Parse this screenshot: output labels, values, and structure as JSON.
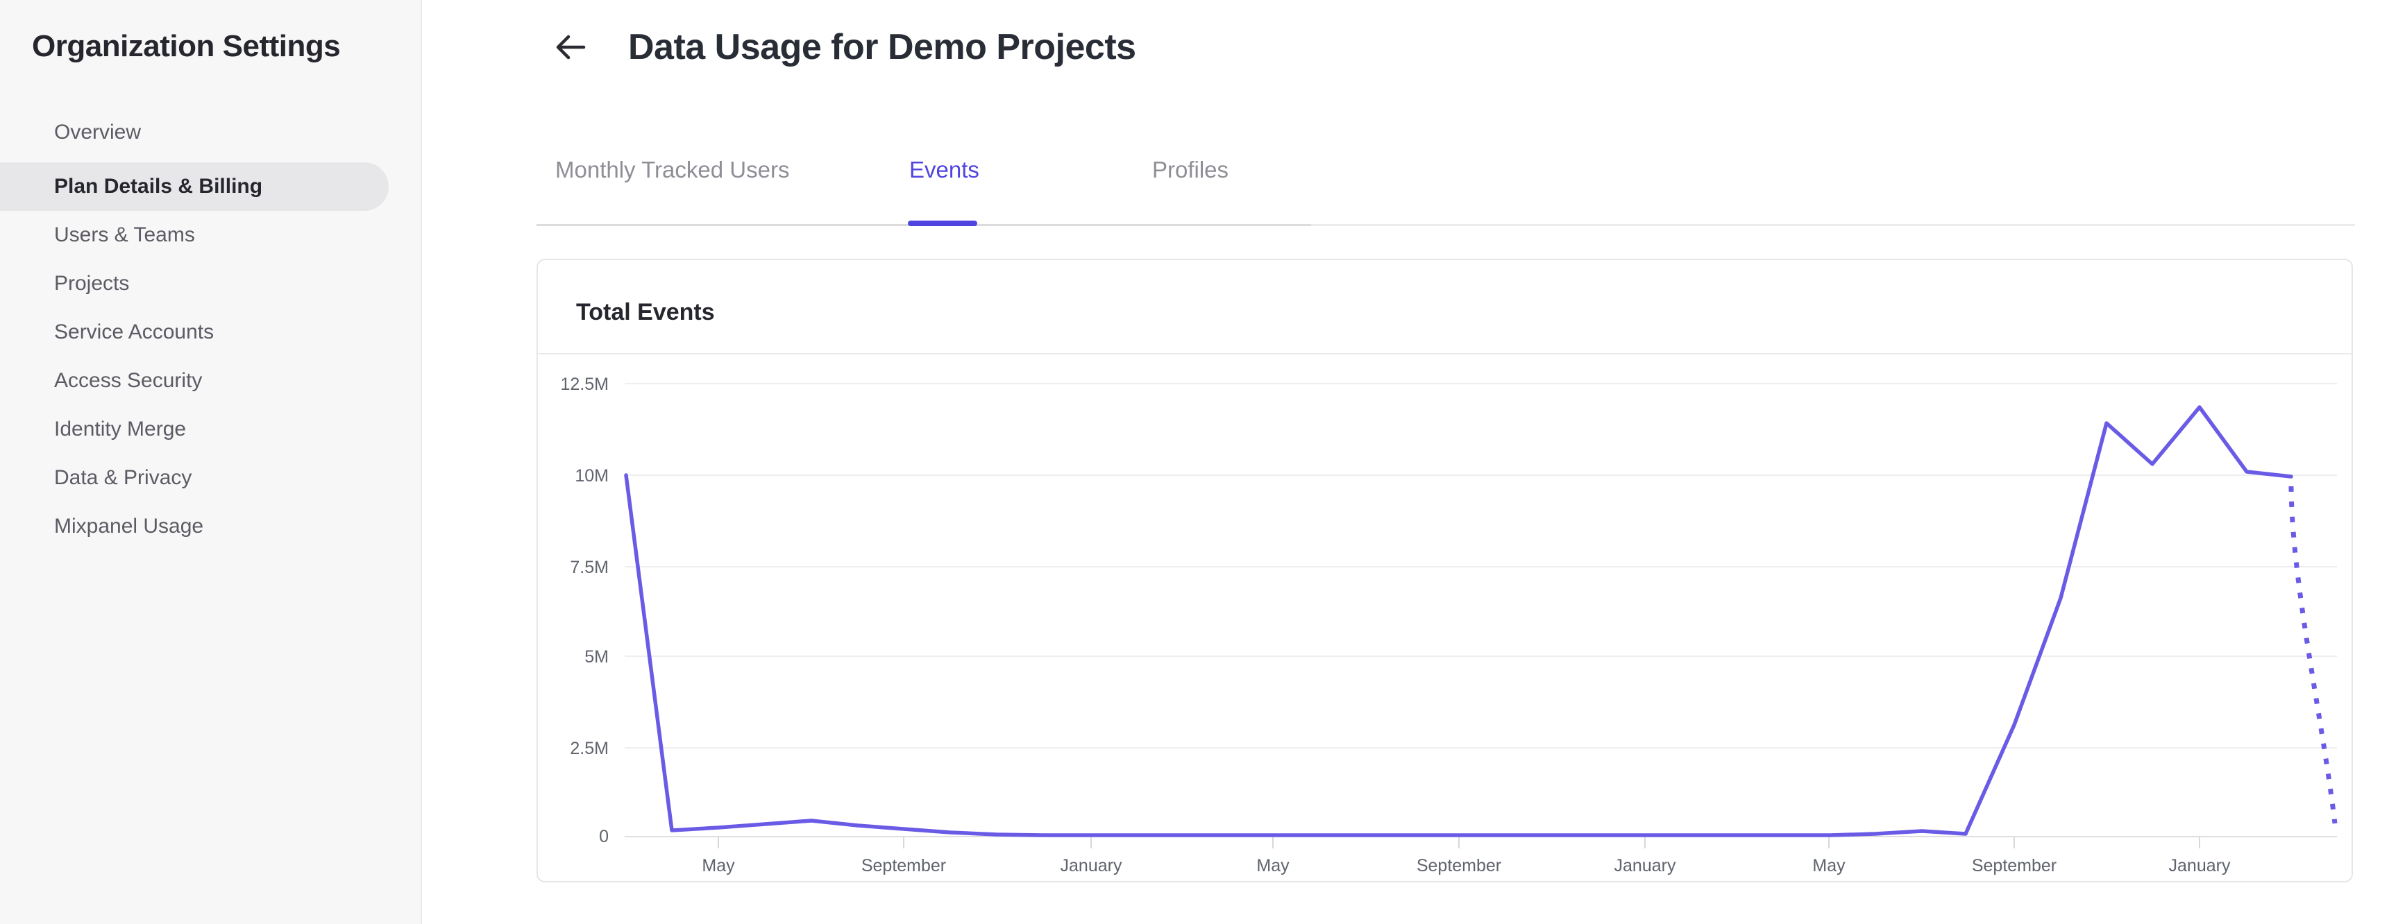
{
  "sidebar": {
    "title": "Organization Settings",
    "items": [
      {
        "label": "Overview",
        "selected": false
      },
      {
        "label": "Plan Details & Billing",
        "selected": true
      },
      {
        "label": "Users & Teams",
        "selected": false
      },
      {
        "label": "Projects",
        "selected": false
      },
      {
        "label": "Service Accounts",
        "selected": false
      },
      {
        "label": "Access Security",
        "selected": false
      },
      {
        "label": "Identity Merge",
        "selected": false
      },
      {
        "label": "Data & Privacy",
        "selected": false
      },
      {
        "label": "Mixpanel Usage",
        "selected": false
      }
    ]
  },
  "header": {
    "title": "Data Usage for Demo Projects",
    "back_icon": "left-arrow-icon"
  },
  "tabs": {
    "items": [
      {
        "label": "Monthly Tracked Users",
        "active": false
      },
      {
        "label": "Events",
        "active": true
      },
      {
        "label": "Profiles",
        "active": false
      }
    ]
  },
  "card": {
    "title": "Total Events"
  },
  "colors": {
    "accent_purple": "#4f44e0",
    "line_purple": "#6a5be6",
    "sidebar_bg": "#f7f7f8",
    "selected_pill": "#e7e7ea",
    "gridline": "#eeeeef",
    "axis": "#dedee1",
    "muted_text": "#5f636b",
    "inactive_tab_text": "#8e8e96"
  },
  "chart_data": {
    "type": "line",
    "title": "Total Events",
    "unit": "events",
    "y_ticks": [
      "12.5M",
      "10M",
      "7.5M",
      "5M",
      "2.5M",
      "0"
    ],
    "ylim": [
      0,
      12500000
    ],
    "x_ticks": [
      "May",
      "September",
      "January",
      "May",
      "September",
      "January",
      "May",
      "September",
      "January"
    ],
    "x_axis_note": "monthly data points; x = months from first plotted point; axis tick labels sit at month offsets 2, 6, 10, 14, 18, 22, 26, 30, 34",
    "grid": "horizontal-only",
    "legend": "none",
    "series": [
      {
        "name": "Total Events",
        "style": "solid",
        "points_millions": [
          [
            0,
            10.0
          ],
          [
            1,
            0.17
          ],
          [
            2,
            0.25
          ],
          [
            3,
            0.35
          ],
          [
            4,
            0.45
          ],
          [
            5,
            0.33
          ],
          [
            6,
            0.22
          ],
          [
            7,
            0.12
          ],
          [
            8,
            0.06
          ],
          [
            9,
            0.04
          ],
          [
            10,
            0.04
          ],
          [
            14,
            0.04
          ],
          [
            18,
            0.04
          ],
          [
            22,
            0.04
          ],
          [
            26,
            0.04
          ],
          [
            27,
            0.07
          ],
          [
            28,
            0.15
          ],
          [
            29,
            0.07
          ],
          [
            30,
            3.1
          ],
          [
            31,
            6.6
          ],
          [
            32,
            11.4
          ],
          [
            33,
            10.25
          ],
          [
            34,
            11.85
          ],
          [
            35,
            10.05
          ],
          [
            36,
            9.95
          ]
        ]
      },
      {
        "name": "Total Events (projected)",
        "style": "dotted",
        "points_millions": [
          [
            36,
            9.95
          ],
          [
            37,
            0.35
          ]
        ]
      }
    ]
  }
}
